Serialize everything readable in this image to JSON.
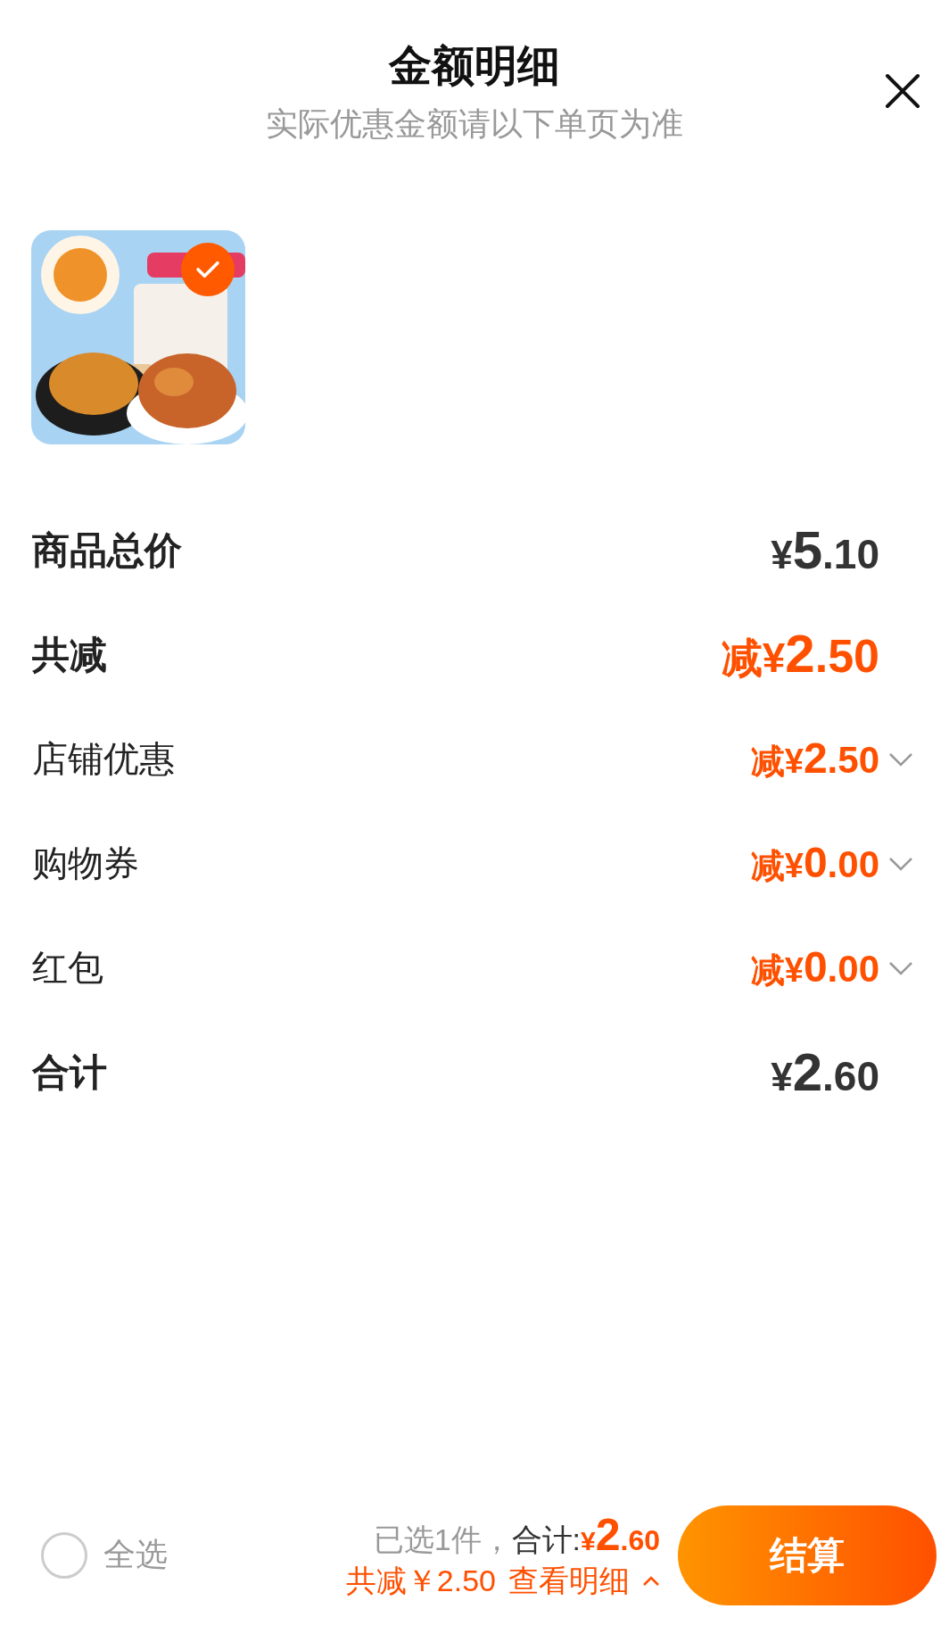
{
  "header": {
    "title": "金额明细",
    "subtitle": "实际优惠金额请以下单页为准"
  },
  "products": [
    {
      "kind": "picture",
      "selected": true
    }
  ],
  "rows": [
    {
      "kind": "total",
      "label": "商品总价",
      "price": {
        "prefix": "¥",
        "integer": "5",
        "decimal": ".10"
      }
    },
    {
      "kind": "discount_total",
      "label": "共减",
      "price": {
        "prefix": "减¥",
        "integer": "2",
        "decimal": ".50"
      }
    },
    {
      "kind": "discount",
      "label": "店铺优惠",
      "price": {
        "prefix": "减¥",
        "integer": "2",
        "decimal": ".50"
      },
      "expanded": false
    },
    {
      "kind": "discount",
      "label": "购物券",
      "price": {
        "prefix": "减¥",
        "integer": "0",
        "decimal": ".00"
      },
      "expanded": false
    },
    {
      "kind": "discount",
      "label": "红包",
      "price": {
        "prefix": "减¥",
        "integer": "0",
        "decimal": ".00"
      },
      "expanded": false
    },
    {
      "kind": "total",
      "label": "合计",
      "price": {
        "prefix": "¥",
        "integer": "2",
        "decimal": ".60"
      }
    }
  ],
  "footer": {
    "select_all": {
      "label": "全选",
      "checked": false
    },
    "selected_count": "已选1件，",
    "total_label": "合计:",
    "total": {
      "prefix": "¥",
      "integer": "2",
      "decimal": ".60"
    },
    "savings": "共减￥2.50",
    "details_link": {
      "label": "查看明细",
      "expanded": false
    },
    "checkout_button": "结算"
  }
}
